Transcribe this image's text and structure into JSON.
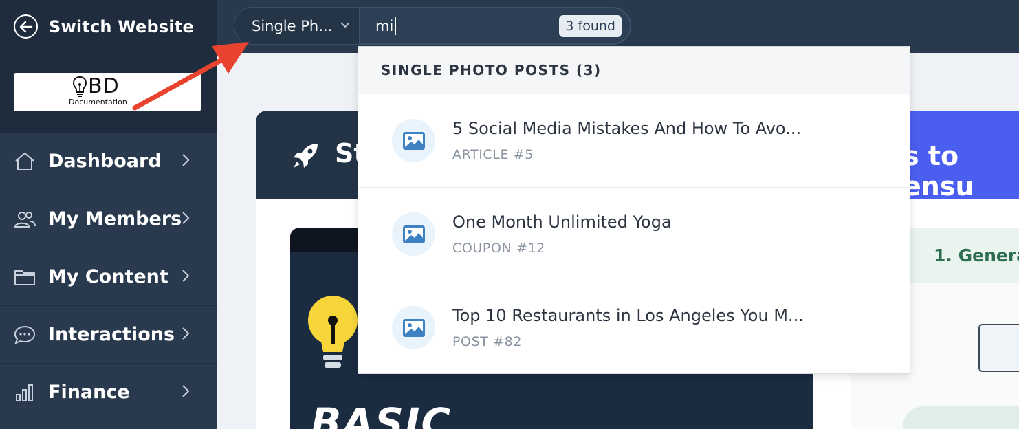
{
  "sidebar": {
    "switch_label": "Switch Website",
    "logo": {
      "text": "BD",
      "subtext": "Documentation"
    },
    "items": [
      {
        "label": "Dashboard",
        "icon": "home-icon"
      },
      {
        "label": "My Members",
        "icon": "users-icon"
      },
      {
        "label": "My Content",
        "icon": "folder-icon"
      },
      {
        "label": "Interactions",
        "icon": "chat-icon"
      },
      {
        "label": "Finance",
        "icon": "bar-chart-icon"
      }
    ]
  },
  "search": {
    "type_selected": "Single Ph...",
    "query": "mi",
    "found_badge": "3 found"
  },
  "dropdown": {
    "group_header": "SINGLE PHOTO POSTS (3)",
    "results": [
      {
        "title": "5 Social Media Mistakes And How To Avo...",
        "subtitle": "ARTICLE #5"
      },
      {
        "title": "One Month Unlimited Yoga",
        "subtitle": "COUPON #12"
      },
      {
        "title": "Top 10 Restaurants in Los Angeles You M...",
        "subtitle": "POST #82"
      }
    ]
  },
  "background": {
    "card_title_partial": "St",
    "card_title_right": "s to ensu",
    "video_text": "BASIC",
    "side_heading": "1. Genera"
  },
  "colors": {
    "sidebar": "#2a3a4e",
    "sidebar_dark": "#1f2c3d",
    "accent_blue": "#4a5ef0",
    "arrow_red": "#e8432f",
    "icon_blue": "#3e82c4"
  }
}
